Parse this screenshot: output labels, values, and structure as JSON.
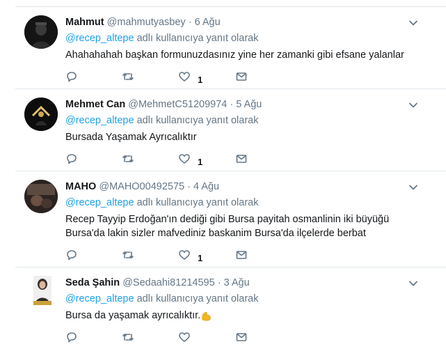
{
  "tweets": [
    {
      "name": "Mahmut",
      "handle": "@mahmutyasbey",
      "dot": "·",
      "date": "6 Ağu",
      "reply_mention": "@recep_altepe",
      "reply_suffix": " adlı kullanıcıya yanıt olarak",
      "text": "Ahahahahah başkan formunuzdasınız yine her zamanki gibi efsane yalanlar",
      "likes": "1"
    },
    {
      "name": "Mehmet Can",
      "handle": "@MehmetC51209974",
      "dot": "·",
      "date": "5 Ağu",
      "reply_mention": "@recep_altepe",
      "reply_suffix": " adlı kullanıcıya yanıt olarak",
      "text": "Bursada Yaşamak Ayrıcalıktır",
      "likes": "1"
    },
    {
      "name": "MAHO",
      "handle": "@MAHO00492575",
      "dot": "·",
      "date": "4 Ağu",
      "reply_mention": "@recep_altepe",
      "reply_suffix": " adlı kullanıcıya yanıt olarak",
      "text": "Recep Tayyip Erdoğan'ın dediği gibi Bursa payitah osmanlinin iki büyüğü Bursa'da lakin sizler mafvediniz baskanim Bursa'da ilçelerde berbat",
      "likes": "1"
    },
    {
      "name": "Seda Şahin",
      "handle": "@Sedaahi81214595",
      "dot": "·",
      "date": "3 Ağu",
      "reply_mention": "@recep_altepe",
      "reply_suffix": " adlı kullanıcıya yanıt olarak",
      "text": "Bursa da yaşamak ayrıcalıktır.",
      "likes": ""
    }
  ],
  "icons": {
    "reply": "reply-icon",
    "retweet": "retweet-icon",
    "like": "heart-icon",
    "dm": "envelope-icon",
    "more": "chevron-down-icon",
    "emoji": "flexed-biceps-emoji"
  },
  "colors": {
    "icon": "#657786",
    "link": "#1da1f2",
    "divider": "#e1e8ed",
    "text": "#14171a"
  }
}
